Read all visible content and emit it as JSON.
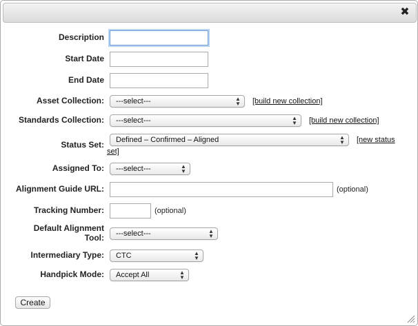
{
  "dialog": {
    "close_icon": "close-icon"
  },
  "fields": {
    "description": {
      "label": "Description",
      "value": ""
    },
    "start_date": {
      "label": "Start Date",
      "value": ""
    },
    "end_date": {
      "label": "End Date",
      "value": ""
    },
    "asset_collection": {
      "label": "Asset Collection:",
      "selected": "---select---",
      "link": "[build new collection]"
    },
    "standards_collection": {
      "label": "Standards Collection:",
      "selected": "---select---",
      "link": "[build new collection]"
    },
    "status_set": {
      "label": "Status Set:",
      "selected": "Defined – Confirmed – Aligned",
      "link_part1": "[new status",
      "link_part2": "set]"
    },
    "assigned_to": {
      "label": "Assigned To:",
      "selected": "---select---"
    },
    "alignment_guide_url": {
      "label": "Alignment Guide URL:",
      "value": "",
      "hint": "(optional)"
    },
    "tracking_number": {
      "label": "Tracking Number:",
      "value": "",
      "hint": "(optional)"
    },
    "default_alignment_tool": {
      "label_line1": "Default Alignment",
      "label_line2": "Tool:",
      "selected": "---select---"
    },
    "intermediary_type": {
      "label": "Intermediary Type:",
      "selected": "CTC"
    },
    "handpick_mode": {
      "label": "Handpick Mode:",
      "selected": "Accept All"
    }
  },
  "actions": {
    "create_label": "Create"
  },
  "icons": {
    "select_arrow": "up-down-arrows-icon",
    "close": "close-icon",
    "resize": "resize-grip-icon"
  },
  "colors": {
    "focus_ring": "#b9d3f2",
    "focus_border": "#6b9fd6"
  }
}
